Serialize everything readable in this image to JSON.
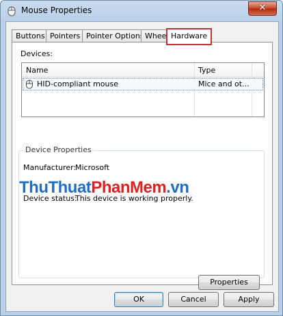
{
  "window": {
    "title": "Mouse Properties",
    "close_label": "✕"
  },
  "tabs": [
    {
      "label": "Buttons"
    },
    {
      "label": "Pointers"
    },
    {
      "label": "Pointer Options"
    },
    {
      "label": "Wheel"
    },
    {
      "label": "Hardware",
      "active": true
    }
  ],
  "hardware": {
    "devices_label": "Devices:",
    "columns": {
      "name": "Name",
      "type": "Type"
    },
    "rows": [
      {
        "name": "HID-compliant mouse",
        "type": "Mice and ot...",
        "icon": "mouse-icon",
        "selected": true
      }
    ],
    "group_label": "Device Properties",
    "manufacturer_label": "Manufacturer:",
    "manufacturer_value": "Microsoft",
    "status_label": "Device status:",
    "status_value": "This device is working properly.",
    "properties_button": "Properties"
  },
  "watermark": {
    "part1": "ThuThuat",
    "part2": "PhanMem",
    "part3": ".vn"
  },
  "buttons": {
    "ok": "OK",
    "cancel": "Cancel",
    "apply": "Apply"
  },
  "colors": {
    "highlight": "#c0333a",
    "watermark_blue": "#1f6fc4",
    "watermark_red": "#e02020"
  }
}
